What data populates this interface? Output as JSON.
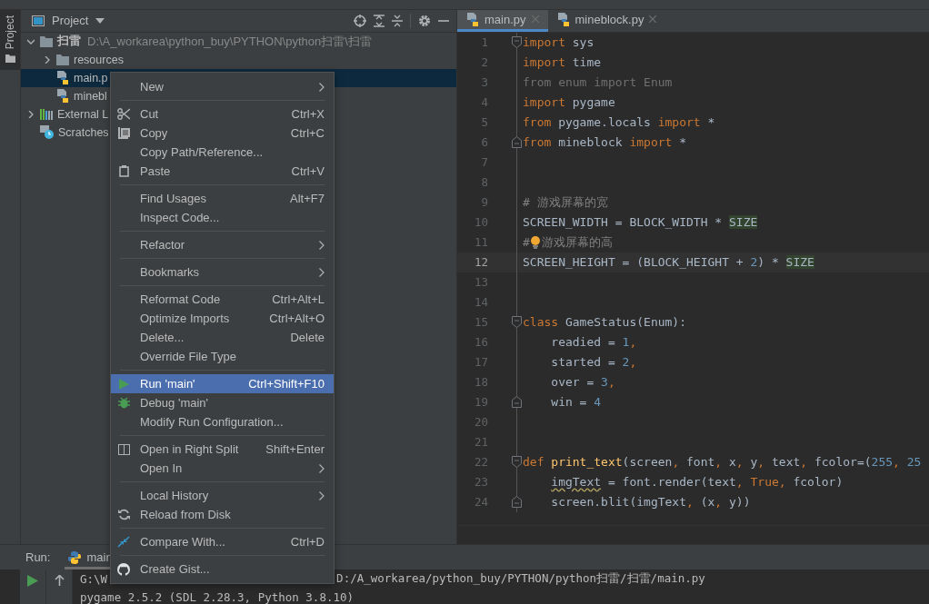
{
  "tool_stripe": {
    "label": "Project",
    "selected": true
  },
  "project": {
    "title": "Project",
    "tree": [
      {
        "label": "扫雷",
        "path": "D:\\A_workarea\\python_buy\\PYTHON\\python扫雷\\扫雷",
        "kind": "folder",
        "expanded": true,
        "selected": false,
        "children": [
          {
            "label": "resources",
            "kind": "folder",
            "expanded": false,
            "selected": false
          },
          {
            "label": "main.p",
            "kind": "python_file",
            "selected": true
          },
          {
            "label": "minebl",
            "kind": "python_file",
            "selected": false
          }
        ]
      },
      {
        "label": "External L",
        "kind": "library",
        "expanded": false,
        "selected": false
      },
      {
        "label": "Scratches",
        "kind": "scratches",
        "selected": false
      }
    ]
  },
  "tabs": [
    {
      "label": "main.py",
      "selected": true
    },
    {
      "label": "mineblock.py",
      "selected": false
    }
  ],
  "code": [
    {
      "number": "1",
      "kind": "fold_start",
      "current": false,
      "tokens": [
        {
          "text": "import",
          "kind": "keyword"
        },
        {
          "text": " sys",
          "kind": "plain"
        }
      ]
    },
    {
      "number": "2",
      "kind": "plain",
      "current": false,
      "tokens": [
        {
          "text": "import",
          "kind": "keyword"
        },
        {
          "text": " time",
          "kind": "plain"
        }
      ]
    },
    {
      "number": "3",
      "kind": "plain",
      "current": false,
      "tokens": [
        {
          "text": "from enum import Enum",
          "kind": "unused"
        }
      ]
    },
    {
      "number": "4",
      "kind": "plain",
      "current": false,
      "tokens": [
        {
          "text": "import",
          "kind": "keyword"
        },
        {
          "text": " pygame",
          "kind": "plain"
        }
      ]
    },
    {
      "number": "5",
      "kind": "plain",
      "current": false,
      "tokens": [
        {
          "text": "from",
          "kind": "keyword"
        },
        {
          "text": " pygame.locals ",
          "kind": "plain"
        },
        {
          "text": "import",
          "kind": "keyword"
        },
        {
          "text": " *",
          "kind": "plain"
        }
      ]
    },
    {
      "number": "6",
      "kind": "fold_end",
      "current": false,
      "tokens": [
        {
          "text": "from",
          "kind": "keyword"
        },
        {
          "text": " mineblock ",
          "kind": "plain"
        },
        {
          "text": "import",
          "kind": "keyword"
        },
        {
          "text": " *",
          "kind": "plain"
        }
      ]
    },
    {
      "number": "7",
      "kind": "plain",
      "current": false
    },
    {
      "number": "8",
      "kind": "plain",
      "current": false
    },
    {
      "number": "9",
      "kind": "plain",
      "current": false,
      "tokens": [
        {
          "text": "# 游戏屏幕的宽",
          "kind": "comment"
        }
      ]
    },
    {
      "number": "10",
      "kind": "plain",
      "current": false,
      "tokens": [
        {
          "text": "SCREEN_WIDTH = BLOCK_WIDTH * ",
          "kind": "plain"
        },
        {
          "text": "SIZE",
          "kind": "match"
        }
      ]
    },
    {
      "number": "11",
      "kind": "plain",
      "current": false,
      "bulb": true,
      "tokens": [
        {
          "text": "#",
          "kind": "comment"
        },
        {
          "text": "游戏屏幕的高",
          "kind": "comment"
        }
      ]
    },
    {
      "number": "12",
      "kind": "plain",
      "current": true,
      "tokens": [
        {
          "text": "SCREEN_HEIGHT = (BLOCK_HEIGHT + ",
          "kind": "plain"
        },
        {
          "text": "2",
          "kind": "number"
        },
        {
          "text": ") * ",
          "kind": "plain"
        },
        {
          "text": "SIZE",
          "kind": "match"
        }
      ]
    },
    {
      "number": "13",
      "kind": "plain",
      "current": false
    },
    {
      "number": "14",
      "kind": "plain",
      "current": false
    },
    {
      "number": "15",
      "kind": "fold_start",
      "current": false,
      "tokens": [
        {
          "text": "class",
          "kind": "keyword"
        },
        {
          "text": " GameStatus(Enum):",
          "kind": "plain"
        }
      ]
    },
    {
      "number": "16",
      "kind": "plain",
      "current": false,
      "tokens": [
        {
          "text": "    readied = ",
          "kind": "plain"
        },
        {
          "text": "1",
          "kind": "number"
        },
        {
          "text": ",",
          "kind": "keyword"
        }
      ]
    },
    {
      "number": "17",
      "kind": "plain",
      "current": false,
      "tokens": [
        {
          "text": "    started = ",
          "kind": "plain"
        },
        {
          "text": "2",
          "kind": "number"
        },
        {
          "text": ",",
          "kind": "keyword"
        }
      ]
    },
    {
      "number": "18",
      "kind": "plain",
      "current": false,
      "tokens": [
        {
          "text": "    over = ",
          "kind": "plain"
        },
        {
          "text": "3",
          "kind": "number"
        },
        {
          "text": ",",
          "kind": "keyword"
        }
      ]
    },
    {
      "number": "19",
      "kind": "fold_end",
      "current": false,
      "tokens": [
        {
          "text": "    win = ",
          "kind": "plain"
        },
        {
          "text": "4",
          "kind": "number"
        }
      ]
    },
    {
      "number": "20",
      "kind": "plain",
      "current": false
    },
    {
      "number": "21",
      "kind": "plain",
      "current": false
    },
    {
      "number": "22",
      "kind": "fold_start",
      "current": false,
      "tokens": [
        {
          "text": "def ",
          "kind": "keyword"
        },
        {
          "text": "print_text",
          "kind": "function"
        },
        {
          "text": "(screen",
          "kind": "plain"
        },
        {
          "text": ",",
          "kind": "keyword"
        },
        {
          "text": " font",
          "kind": "plain"
        },
        {
          "text": ",",
          "kind": "keyword"
        },
        {
          "text": " x",
          "kind": "plain"
        },
        {
          "text": ",",
          "kind": "keyword"
        },
        {
          "text": " y",
          "kind": "plain"
        },
        {
          "text": ",",
          "kind": "keyword"
        },
        {
          "text": " text",
          "kind": "plain"
        },
        {
          "text": ",",
          "kind": "keyword"
        },
        {
          "text": " fcolor=(",
          "kind": "plain"
        },
        {
          "text": "255",
          "kind": "number"
        },
        {
          "text": ", ",
          "kind": "keyword"
        },
        {
          "text": "25",
          "kind": "number"
        }
      ]
    },
    {
      "number": "23",
      "kind": "plain",
      "current": false,
      "tokens": [
        {
          "text": "    imgText",
          "kind": "warning"
        },
        {
          "text": " = font.render(text",
          "kind": "plain"
        },
        {
          "text": ",",
          "kind": "keyword"
        },
        {
          "text": " True",
          "kind": "keyword"
        },
        {
          "text": ",",
          "kind": "keyword"
        },
        {
          "text": " fcolor)",
          "kind": "plain"
        }
      ]
    },
    {
      "number": "24",
      "kind": "fold_end",
      "current": false,
      "tokens": [
        {
          "text": "    screen.blit(imgText",
          "kind": "plain"
        },
        {
          "text": ",",
          "kind": "keyword"
        },
        {
          "text": " (x",
          "kind": "plain"
        },
        {
          "text": ",",
          "kind": "keyword"
        },
        {
          "text": " y))",
          "kind": "plain"
        }
      ]
    }
  ],
  "run": {
    "label": "Run:",
    "tab": "main",
    "console": [
      {
        "parts": [
          "G:\\W",
          "D:/A_workarea/python_buy/PYTHON/python扫雷/扫雷/main.py"
        ]
      },
      {
        "parts": [
          "pygame 2.5.2 (SDL 2.28.3, Python 3.8.10)"
        ]
      }
    ]
  },
  "context_menu": [
    {
      "kind": "plain",
      "label": "New",
      "submenu": true,
      "selected": false
    },
    {
      "kind": "separator"
    },
    {
      "kind": "cut",
      "label": "Cut",
      "shortcut": "Ctrl+X",
      "selected": false
    },
    {
      "kind": "copy",
      "label": "Copy",
      "shortcut": "Ctrl+C",
      "selected": false
    },
    {
      "kind": "plain",
      "label": "Copy Path/Reference...",
      "selected": false
    },
    {
      "kind": "paste",
      "label": "Paste",
      "shortcut": "Ctrl+V",
      "selected": false
    },
    {
      "kind": "separator"
    },
    {
      "kind": "plain",
      "label": "Find Usages",
      "shortcut": "Alt+F7",
      "selected": false
    },
    {
      "kind": "plain",
      "label": "Inspect Code...",
      "selected": false
    },
    {
      "kind": "separator"
    },
    {
      "kind": "plain",
      "label": "Refactor",
      "submenu": true,
      "selected": false
    },
    {
      "kind": "separator"
    },
    {
      "kind": "plain",
      "label": "Bookmarks",
      "submenu": true,
      "selected": false
    },
    {
      "kind": "separator"
    },
    {
      "kind": "plain",
      "label": "Reformat Code",
      "shortcut": "Ctrl+Alt+L",
      "selected": false
    },
    {
      "kind": "plain",
      "label": "Optimize Imports",
      "shortcut": "Ctrl+Alt+O",
      "selected": false
    },
    {
      "kind": "plain",
      "label": "Delete...",
      "shortcut": "Delete",
      "selected": false
    },
    {
      "kind": "plain",
      "label": "Override File Type",
      "selected": false
    },
    {
      "kind": "separator"
    },
    {
      "kind": "run",
      "label": "Run 'main'",
      "shortcut": "Ctrl+Shift+F10",
      "selected": true
    },
    {
      "kind": "debug",
      "label": "Debug 'main'",
      "selected": false
    },
    {
      "kind": "plain",
      "label": "Modify Run Configuration...",
      "selected": false
    },
    {
      "kind": "separator"
    },
    {
      "kind": "split",
      "label": "Open in Right Split",
      "shortcut": "Shift+Enter",
      "selected": false
    },
    {
      "kind": "plain",
      "label": "Open In",
      "submenu": true,
      "selected": false
    },
    {
      "kind": "separator"
    },
    {
      "kind": "plain",
      "label": "Local History",
      "submenu": true,
      "selected": false
    },
    {
      "kind": "reload",
      "label": "Reload from Disk",
      "selected": false
    },
    {
      "kind": "separator"
    },
    {
      "kind": "compare",
      "label": "Compare With...",
      "shortcut": "Ctrl+D",
      "selected": false
    },
    {
      "kind": "separator"
    },
    {
      "kind": "gist",
      "label": "Create Gist...",
      "selected": false
    }
  ]
}
